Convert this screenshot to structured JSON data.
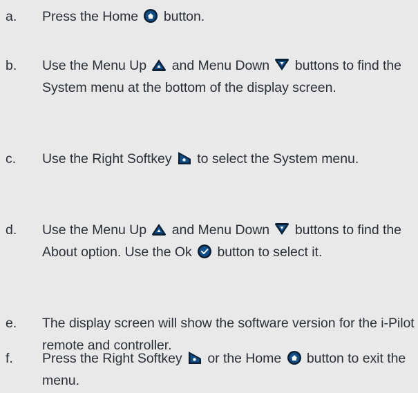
{
  "steps": [
    {
      "letter": "a.",
      "parts": [
        "Press the Home",
        "button."
      ],
      "icons": [
        "home-button-icon"
      ]
    },
    {
      "letter": "b.",
      "parts": [
        "Use the Menu Up",
        "and Menu Down",
        "buttons to find the System menu at the bottom of the display screen."
      ],
      "icons": [
        "menu-up-icon",
        "menu-down-icon"
      ]
    },
    {
      "letter": "c.",
      "parts": [
        "Use the Right Softkey",
        "to select the System menu."
      ],
      "icons": [
        "right-softkey-icon"
      ]
    },
    {
      "letter": "d.",
      "parts": [
        "Use the Menu Up",
        "and Menu Down",
        "buttons to find the About option. Use the Ok",
        "button to select it."
      ],
      "icons": [
        "menu-up-icon",
        "menu-down-icon",
        "ok-button-icon"
      ]
    },
    {
      "letter": "e.",
      "parts": [
        "The display screen will show the software version for the i-Pilot remote and controller."
      ],
      "icons": []
    },
    {
      "letter": "f.",
      "parts": [
        "Press the Right Softkey",
        "or the Home",
        "button to exit the menu."
      ],
      "icons": [
        "right-softkey-icon",
        "home-button-icon"
      ]
    }
  ],
  "colors": {
    "background": "#e9e9ea",
    "text": "#2a2f36",
    "icon_fill": "#0e4f8c",
    "icon_outline": "#0b1f33"
  }
}
